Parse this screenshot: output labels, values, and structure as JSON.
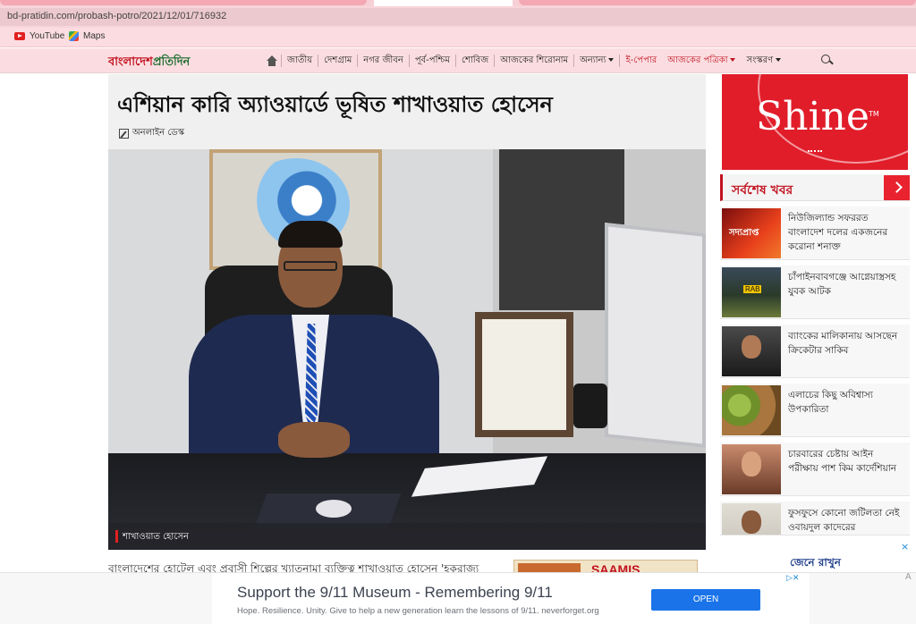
{
  "browser": {
    "url": "bd-pratidin.com/probash-potro/2021/12/01/716932",
    "bookmarks": [
      "YouTube",
      "Maps"
    ]
  },
  "site": {
    "logo_part1": "বাংলাদেশ",
    "logo_part2": "প্রতিদিন",
    "nav": [
      "জাতীয়",
      "দেশগ্রাম",
      "নগর জীবন",
      "পূর্ব-পশ্চিম",
      "শোবিজ",
      "আজকের শিরোনাম",
      "অন্যান্য",
      "ই-পেপার",
      "আজকের পত্রিকা",
      "সংস্করণ"
    ]
  },
  "article": {
    "headline": "এশিয়ান কারি অ্যাওয়ার্ডে ভূষিত শাখাওয়াত হোসেন",
    "byline": "অনলাইন ডেস্ক",
    "photo_caption": "শাখাওয়াত হোসেন",
    "body_start": "বাংলাদেশের হোটেল এবং প্রবাসী শিল্পের খ্যাতনামা ব্যক্তিত্ব শাখাওয়াত হোসেন 'হকরাজ্য",
    "inline_ad_text": "SAAMIS"
  },
  "sidebar": {
    "shine_brand": "Shine",
    "shine_tm": "TM",
    "latest_title": "সর্বশেষ খবর",
    "news": [
      {
        "text": "নিউজিল্যান্ড সফররত বাংলাদেশ দলের একজনের করোনা শনাক্ত",
        "thumb_label": "সদ্যপ্রাপ্ত"
      },
      {
        "text": "চাঁপাইনবাবগঞ্জে আগ্নেয়াস্ত্রসহ যুবক আটক",
        "thumb_label": "RAB"
      },
      {
        "text": "ব্যাংকের মালিকানায় আসছেন ক্রিকেটার সাকিব",
        "thumb_label": ""
      },
      {
        "text": "এলাচের কিছু অবিশ্বাস্য উপকারিতা",
        "thumb_label": ""
      },
      {
        "text": "চারবারের চেষ্টায় আইন পরীক্ষায় পাশ কিম কার্দেশিয়ান",
        "thumb_label": ""
      },
      {
        "text": "ফুসফুসে কোনো জটিলতা নেই ওবায়দুল কাদেরের",
        "thumb_label": ""
      }
    ],
    "ad_text": "জেনে রাখুন",
    "ad_close": "×"
  },
  "bottom_ad": {
    "headline": "Support the 9/11 Museum - Remembering 9/11",
    "subtext": "Hope. Resilience. Unity. Give to help a new generation learn the lessons of 9/11. neverforget.org",
    "button": "OPEN",
    "edge_letter": "A"
  },
  "colors": {
    "brand_red": "#c1121f",
    "brand_green": "#1a6b2a",
    "open_button": "#1a73e8"
  }
}
